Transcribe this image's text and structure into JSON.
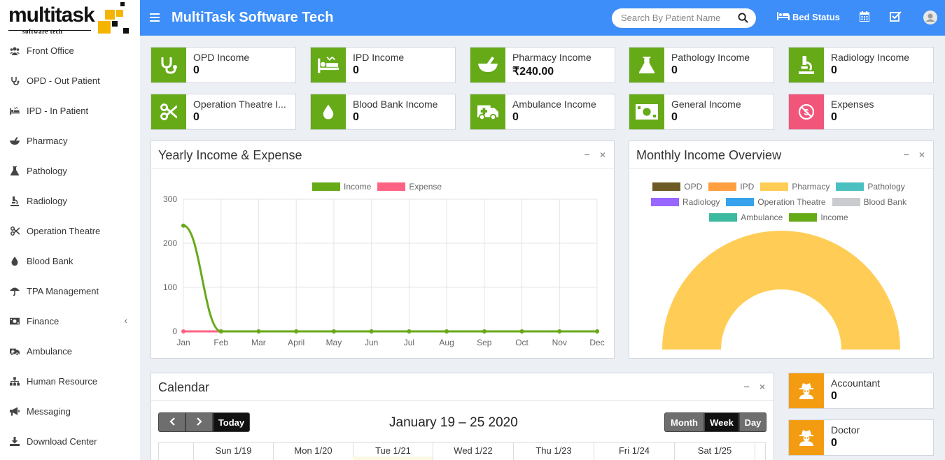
{
  "logo": {
    "word_a": "multi",
    "word_b": "task",
    "tagline": "software tech"
  },
  "header": {
    "title": "MultiTask Software Tech",
    "search_placeholder": "Search By Patient Name",
    "bed_status": "Bed Status"
  },
  "sidebar": {
    "items": [
      {
        "label": "Front Office",
        "icon": "users-icon"
      },
      {
        "label": "OPD - Out Patient",
        "icon": "stethoscope-icon"
      },
      {
        "label": "IPD - In Patient",
        "icon": "procedures-icon"
      },
      {
        "label": "Pharmacy",
        "icon": "mortar-pestle-icon"
      },
      {
        "label": "Pathology",
        "icon": "flask-icon"
      },
      {
        "label": "Radiology",
        "icon": "microscope-icon"
      },
      {
        "label": "Operation Theatre",
        "icon": "scissors-icon"
      },
      {
        "label": "Blood Bank",
        "icon": "tint-icon"
      },
      {
        "label": "TPA Management",
        "icon": "umbrella-icon"
      },
      {
        "label": "Finance",
        "icon": "money-icon"
      },
      {
        "label": "Ambulance",
        "icon": "ambulance-icon"
      },
      {
        "label": "Human Resource",
        "icon": "sitemap-icon"
      },
      {
        "label": "Messaging",
        "icon": "bullhorn-icon"
      },
      {
        "label": "Download Center",
        "icon": "download-icon"
      }
    ],
    "finance_chevron": "‹"
  },
  "stats": [
    {
      "label": "OPD Income",
      "value": "0"
    },
    {
      "label": "IPD Income",
      "value": "0"
    },
    {
      "label": "Pharmacy Income",
      "value": "₹240.00"
    },
    {
      "label": "Pathology Income",
      "value": "0"
    },
    {
      "label": "Radiology Income",
      "value": "0"
    },
    {
      "label": "Operation Theatre I...",
      "value": "0"
    },
    {
      "label": "Blood Bank Income",
      "value": "0"
    },
    {
      "label": "Ambulance Income",
      "value": "0"
    },
    {
      "label": "General Income",
      "value": "0"
    },
    {
      "label": "Expenses",
      "value": "0"
    },
    {
      "label": "Accountant",
      "value": "0"
    },
    {
      "label": "Doctor",
      "value": "0"
    }
  ],
  "colors": {
    "header": "#3d8ef8",
    "green": "#66aa18",
    "expense": "#ff6384",
    "pink": "#f2557a",
    "orange": "#f39c12"
  },
  "panels": {
    "yearly_title": "Yearly Income & Expense",
    "monthly_title": "Monthly Income Overview",
    "calendar_title": "Calendar",
    "minimize": "−",
    "close": "×"
  },
  "chart_data": [
    {
      "type": "line",
      "categories": [
        "Jan",
        "Feb",
        "Mar",
        "April",
        "May",
        "Jun",
        "Jul",
        "Aug",
        "Sep",
        "Oct",
        "Nov",
        "Dec"
      ],
      "series": [
        {
          "name": "Income",
          "color": "#66aa18",
          "values": [
            240,
            0,
            0,
            0,
            0,
            0,
            0,
            0,
            0,
            0,
            0,
            0
          ]
        },
        {
          "name": "Expense",
          "color": "#ff6384",
          "values": [
            0,
            0,
            0,
            0,
            0,
            0,
            0,
            0,
            0,
            0,
            0,
            0
          ]
        }
      ],
      "ylim": [
        0,
        300
      ],
      "yticks": [
        "0",
        "100",
        "200",
        "300"
      ],
      "legend": "top"
    },
    {
      "type": "pie",
      "subtype": "half-doughnut",
      "labels": [
        "OPD",
        "IPD",
        "Pharmacy",
        "Pathology",
        "Radiology",
        "Operation Theatre",
        "Blood Bank",
        "Ambulance",
        "Income"
      ],
      "colors": [
        "#6e5a25",
        "#ff9f40",
        "#ffcd56",
        "#4bc0c0",
        "#9966ff",
        "#36a2eb",
        "#c9cbcf",
        "#3cba9f",
        "#66aa18"
      ],
      "values": [
        0,
        0,
        240,
        0,
        0,
        0,
        0,
        0,
        0
      ],
      "legend": "top"
    }
  ],
  "calendar": {
    "today": "Today",
    "range": "January 19 – 25 2020",
    "views": [
      "Month",
      "Week",
      "Day"
    ],
    "days": [
      "Sun 1/19",
      "Mon 1/20",
      "Tue 1/21",
      "Wed 1/22",
      "Thu 1/23",
      "Fri 1/24",
      "Sat 1/25"
    ]
  }
}
